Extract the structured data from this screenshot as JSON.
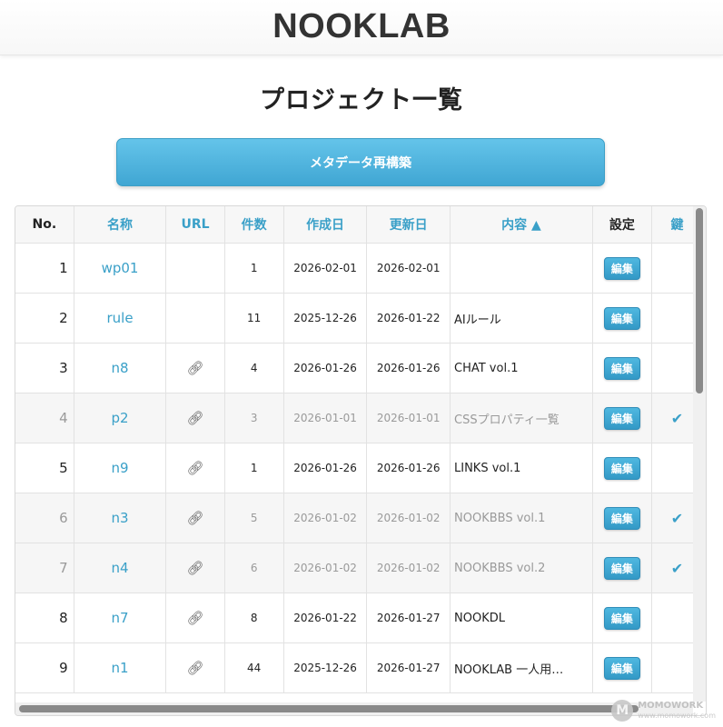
{
  "header": {
    "logo": "NOOKLAB"
  },
  "page": {
    "title": "プロジェクト一覧",
    "rebuild_label": "メタデータ再構築"
  },
  "table": {
    "columns": {
      "no": "No.",
      "name": "名称",
      "url": "URL",
      "count": "件数",
      "created": "作成日",
      "updated": "更新日",
      "content": "内容 ▲",
      "settings": "設定",
      "lock": "鍵"
    },
    "edit_label": "編集",
    "rows": [
      {
        "no": "1",
        "name": "wp01",
        "count": "1",
        "created": "2026-02-01",
        "updated": "2026-02-01",
        "content": "",
        "check": ""
      },
      {
        "no": "2",
        "name": "rule",
        "count": "11",
        "created": "2025-12-26",
        "updated": "2026-01-22",
        "content": "AIルール",
        "check": ""
      },
      {
        "no": "3",
        "name": "n8",
        "count": "4",
        "created": "2026-01-26",
        "updated": "2026-01-26",
        "content": "CHAT vol.1",
        "check": ""
      },
      {
        "no": "4",
        "name": "p2",
        "count": "3",
        "created": "2026-01-01",
        "updated": "2026-01-01",
        "content": "CSSプロパティ一覧",
        "check": "✔"
      },
      {
        "no": "5",
        "name": "n9",
        "count": "1",
        "created": "2026-01-26",
        "updated": "2026-01-26",
        "content": "LINKS vol.1",
        "check": ""
      },
      {
        "no": "6",
        "name": "n3",
        "count": "5",
        "created": "2026-01-02",
        "updated": "2026-01-02",
        "content": "NOOKBBS vol.1",
        "check": "✔"
      },
      {
        "no": "7",
        "name": "n4",
        "count": "6",
        "created": "2026-01-02",
        "updated": "2026-01-02",
        "content": "NOOKBBS vol.2",
        "check": "✔"
      },
      {
        "no": "8",
        "name": "n7",
        "count": "8",
        "created": "2026-01-22",
        "updated": "2026-01-27",
        "content": "NOOKDL",
        "check": ""
      },
      {
        "no": "9",
        "name": "n1",
        "count": "44",
        "created": "2025-12-26",
        "updated": "2026-01-27",
        "content": "NOOKLAB 一人用…",
        "check": ""
      }
    ]
  },
  "watermark": {
    "logo": "M",
    "title": "MOMOWORK",
    "url": "www.momowork.com"
  }
}
